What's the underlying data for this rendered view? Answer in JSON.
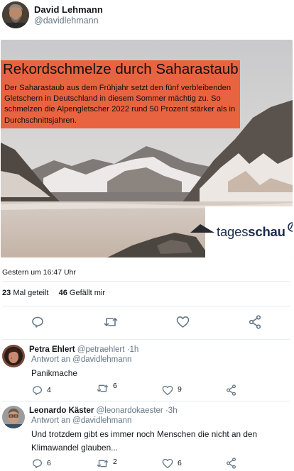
{
  "tweet": {
    "author_name": "David Lehmann",
    "author_handle": "@davidlehmann",
    "media": {
      "headline": "Rekordschmelze durch Saharastaub",
      "caption": "Der Saharastaub aus dem Frühjahr setzt den fünf verbleibenden Gletschern in Deutschland in diesem Sommer mächtig zu. So schmelzen die Alpengletscher 2022 rund 50 Prozent stärker als in Durchschnittsjahren.",
      "logo_light": "tages",
      "logo_bold": "schau",
      "accent_color": "#e8633f"
    },
    "timestamp": "Gestern um 16:47 Uhr",
    "stats": {
      "shares_count": "23",
      "shares_label": "Mal geteilt",
      "likes_count": "46",
      "likes_label": "Gefällt mir"
    },
    "actions": [
      "reply-icon",
      "retweet-icon",
      "heart-icon",
      "share-icon"
    ]
  },
  "replies": [
    {
      "name": "Petra Ehlert",
      "handle": "@petraehlert",
      "dot": "·",
      "time": "1h",
      "reply_to": "Antwort an @davidlehmann",
      "text": "Panikmache",
      "reply_count": "4",
      "retweet_count": "6",
      "like_count": "9"
    },
    {
      "name": "Leonardo Käster",
      "handle": "@leonardokaester",
      "dot": "·",
      "time": "3h",
      "reply_to": "Antwort an @davidlehmann",
      "text": "Und trotzdem gibt es immer noch Menschen die nicht an den Klimawandel glauben...",
      "reply_count": "6",
      "retweet_count": "2",
      "like_count": "6"
    }
  ]
}
